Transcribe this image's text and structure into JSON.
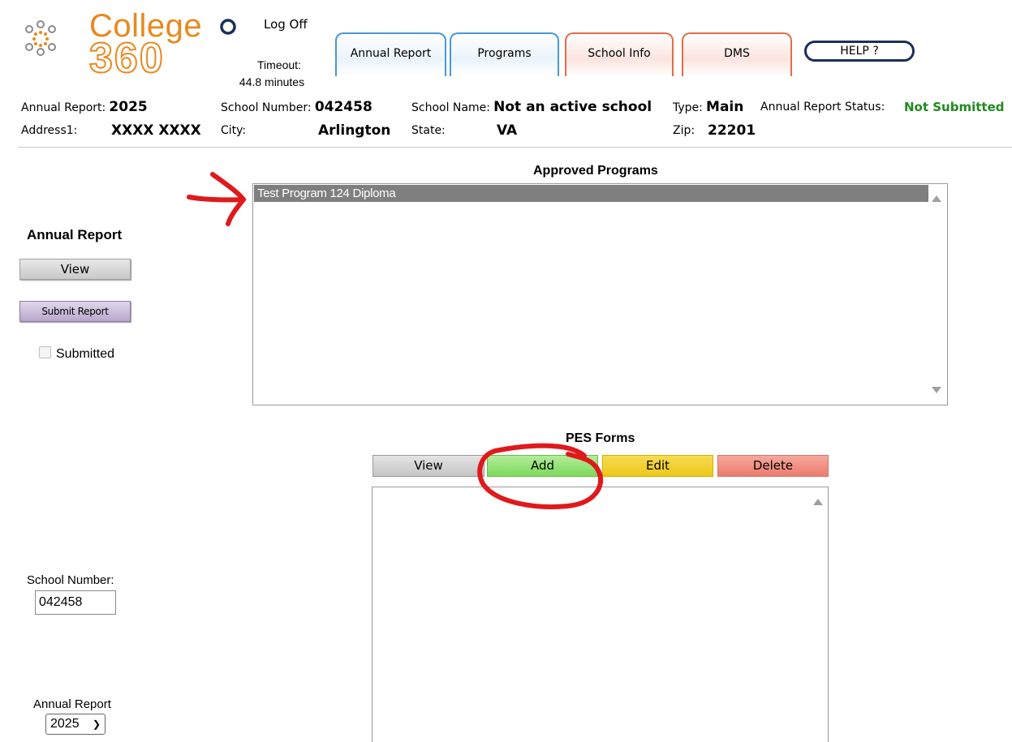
{
  "header": {
    "logo_line1": "College",
    "logo_line2": "360",
    "logoff": "Log Off",
    "timeout_label": "Timeout:",
    "timeout_value": "44.8 minutes",
    "tabs": [
      {
        "label": "Annual Report",
        "color": "#4a97d8"
      },
      {
        "label": "Programs",
        "color": "#4a97d8"
      },
      {
        "label": "School Info",
        "color": "#e56b4a"
      },
      {
        "label": "DMS",
        "color": "#e56b4a"
      }
    ],
    "help": "HELP ?"
  },
  "info": {
    "annual_report_label": "Annual Report:",
    "annual_report_value": "2025",
    "school_number_label": "School Number:",
    "school_number_value": "042458",
    "school_name_label": "School Name:",
    "school_name_value": "Not an active school",
    "type_label": "Type:",
    "type_value": "Main",
    "status_label": "Annual Report Status:",
    "status_value": "Not Submitted",
    "status_color": "#1f8a1f",
    "address_label": "Address1:",
    "address_value": "XXXX XXXX",
    "city_label": "City:",
    "city_value": "Arlington",
    "state_label": "State:",
    "state_value": "VA",
    "zip_label": "Zip:",
    "zip_value": "22201"
  },
  "left": {
    "annual_report_title": "Annual Report",
    "view_button": "View",
    "submit_button": "Submit Report",
    "submitted_label": "Submitted",
    "school_number_label": "School Number:",
    "school_number_value": "042458",
    "annual_report_label": "Annual Report",
    "annual_report_selected": "2025"
  },
  "approved_programs": {
    "title": "Approved Programs",
    "items": [
      "Test Program 124 Diploma"
    ]
  },
  "pes_forms": {
    "title": "PES Forms",
    "view": "View",
    "add": "Add",
    "edit": "Edit",
    "delete": "Delete"
  }
}
